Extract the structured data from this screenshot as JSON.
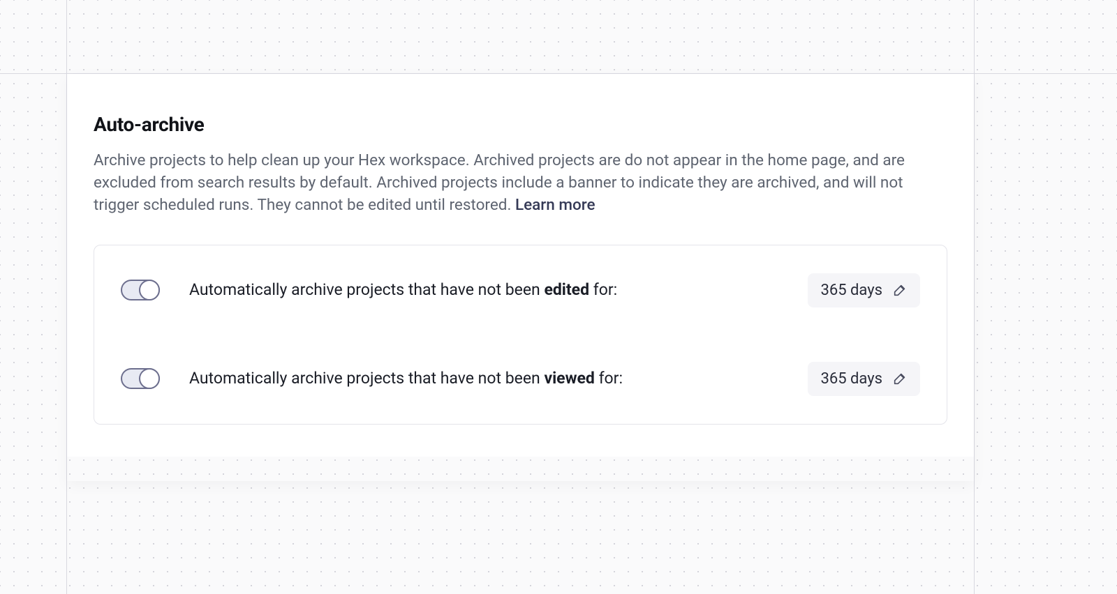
{
  "section": {
    "title": "Auto-archive",
    "description": "Archive projects to help clean up your Hex workspace. Archived projects are do not appear in the home page, and are excluded from search results by default. Archived projects include a banner to indicate they are archived, and will not trigger scheduled runs. They cannot be edited until restored. ",
    "learn_more": "Learn more"
  },
  "settings": {
    "edited": {
      "label_prefix": "Automatically archive projects that have not been ",
      "label_bold": "edited",
      "label_suffix": " for:",
      "value": "365 days"
    },
    "viewed": {
      "label_prefix": "Automatically archive projects that have not been ",
      "label_bold": "viewed",
      "label_suffix": " for:",
      "value": "365 days"
    }
  }
}
